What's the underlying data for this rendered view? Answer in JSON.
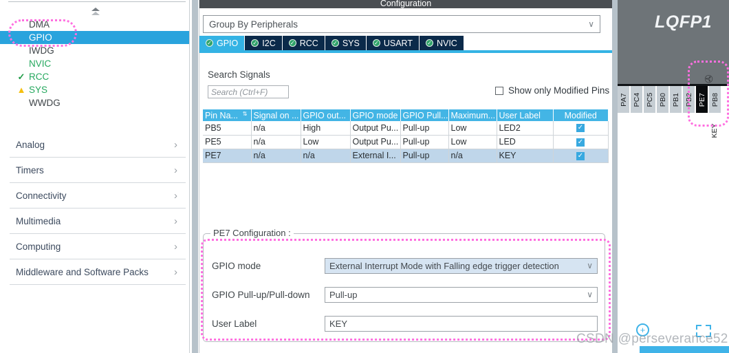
{
  "sidebar": {
    "peripherals": [
      {
        "label": "DMA",
        "mark": "none",
        "state": "normal",
        "selected": false
      },
      {
        "label": "GPIO",
        "mark": "none",
        "state": "normal",
        "selected": true
      },
      {
        "label": "IWDG",
        "mark": "none",
        "state": "normal",
        "selected": false
      },
      {
        "label": "NVIC",
        "mark": "none",
        "state": "green",
        "selected": false
      },
      {
        "label": "RCC",
        "mark": "check",
        "state": "green",
        "selected": false
      },
      {
        "label": "SYS",
        "mark": "warn",
        "state": "green",
        "selected": false
      },
      {
        "label": "WWDG",
        "mark": "none",
        "state": "normal",
        "selected": false
      }
    ],
    "categories": [
      {
        "label": "Analog"
      },
      {
        "label": "Timers"
      },
      {
        "label": "Connectivity"
      },
      {
        "label": "Multimedia"
      },
      {
        "label": "Computing"
      },
      {
        "label": "Middleware and Software Packs"
      }
    ],
    "chevron_glyph": "›"
  },
  "config": {
    "title": "Configuration",
    "group_by": {
      "value": "Group By Peripherals",
      "caret": "∨"
    },
    "tabs": [
      {
        "label": "GPIO",
        "active": true
      },
      {
        "label": "I2C",
        "active": false
      },
      {
        "label": "RCC",
        "active": false
      },
      {
        "label": "SYS",
        "active": false
      },
      {
        "label": "USART",
        "active": false
      },
      {
        "label": "NVIC",
        "active": false
      }
    ],
    "tab_status_glyph": "✓",
    "search": {
      "label": "Search Signals",
      "placeholder": "Search (Ctrl+F)",
      "value": ""
    },
    "show_modified_pins": {
      "label": "Show only Modified Pins",
      "checked": false
    },
    "table": {
      "columns": [
        "Pin Na...",
        "Signal on ...",
        "GPIO out...",
        "GPIO mode",
        "GPIO Pull...",
        "Maximum...",
        "User Label",
        "Modified"
      ],
      "sort_glyph": "⇅",
      "check_glyph": "✓",
      "rows": [
        {
          "selected": false,
          "cells": [
            "PB5",
            "n/a",
            "High",
            "Output Pu...",
            "Pull-up",
            "Low",
            "LED2"
          ],
          "modified": true
        },
        {
          "selected": false,
          "cells": [
            "PE5",
            "n/a",
            "Low",
            "Output Pu...",
            "Pull-up",
            "Low",
            "LED"
          ],
          "modified": true
        },
        {
          "selected": true,
          "cells": [
            "PE7",
            "n/a",
            "n/a",
            "External I...",
            "Pull-up",
            "n/a",
            "KEY"
          ],
          "modified": true
        }
      ]
    },
    "pin_config": {
      "legend": "PE7 Configuration :",
      "fields": [
        {
          "label": "GPIO mode",
          "value": "External Interrupt Mode with Falling edge trigger detection",
          "type": "select",
          "highlighted": true
        },
        {
          "label": "GPIO Pull-up/Pull-down",
          "value": "Pull-up",
          "type": "select",
          "highlighted": false
        },
        {
          "label": "User Label",
          "value": "KEY",
          "type": "text",
          "highlighted": false
        }
      ],
      "caret": "∨"
    }
  },
  "chip": {
    "title": "LQFP1",
    "pins": [
      {
        "label": "PA7",
        "selected": false
      },
      {
        "label": "PC4",
        "selected": false
      },
      {
        "label": "PC5",
        "selected": false
      },
      {
        "label": "PB0",
        "selected": false
      },
      {
        "label": "PB1",
        "selected": false
      },
      {
        "label": "PB2",
        "selected": false
      },
      {
        "label": "PE7",
        "selected": true
      },
      {
        "label": "PB8",
        "selected": false
      }
    ],
    "selected_pin_label": "KEY",
    "pin_marker_glyph": "✇",
    "zoom_in_glyph": "+"
  },
  "watermark": "CSDN @perseverance52",
  "colors": {
    "accent_blue": "#34b3e4",
    "tab_dark": "#0b2a4a",
    "table_header": "#43b5e5",
    "row_selected": "#bfd6ea",
    "annotation_pink": "#ff6fe0",
    "chip_body": "#6e7478"
  }
}
